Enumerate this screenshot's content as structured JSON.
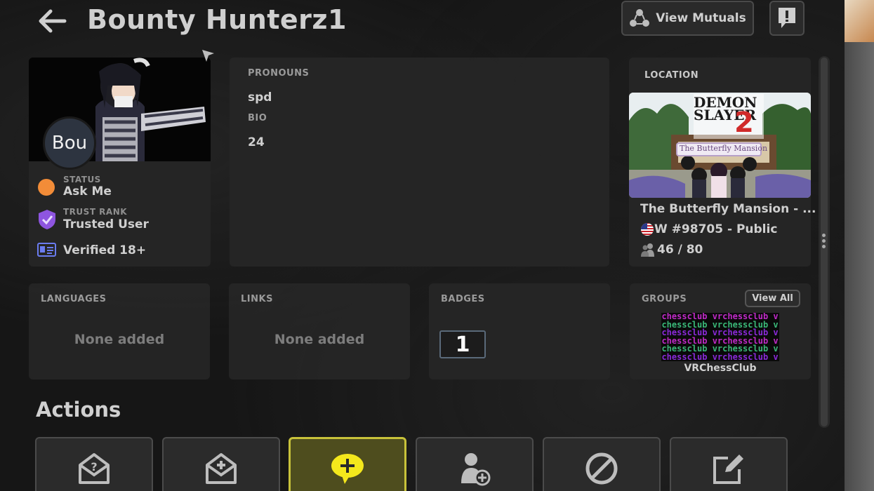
{
  "header": {
    "title": "Bounty Hunterz1",
    "view_mutuals_label": "View Mutuals"
  },
  "profile": {
    "avatar_initials": "Bou",
    "status_label": "STATUS",
    "status_value": "Ask Me",
    "status_color": "#f28c38",
    "trust_rank_label": "TRUST RANK",
    "trust_rank_value": "Trusted User",
    "trust_color": "#8e55e0",
    "verified_label": "Verified 18+",
    "verified_color": "#6a7cf0"
  },
  "about": {
    "pronouns_label": "PRONOUNS",
    "pronouns_value": "spd",
    "bio_label": "BIO",
    "bio_value": "24"
  },
  "location": {
    "label": "LOCATION",
    "world_name": "The Butterfly Mansion - ...",
    "instance": "W #98705 - Public",
    "population": "46 / 80",
    "thumbnail_title_1": "DEMON",
    "thumbnail_title_2": "SLAYER",
    "thumbnail_subtitle": "The Butterfly Mansion"
  },
  "languages": {
    "label": "LANGUAGES",
    "value": "None added"
  },
  "links": {
    "label": "LINKS",
    "value": "None added"
  },
  "badges": {
    "label": "BADGES",
    "count": "1"
  },
  "groups": {
    "label": "GROUPS",
    "view_all_label": "View All",
    "group_name": "VRChessClub",
    "banner_text": "vrchessclub"
  },
  "actions": {
    "title": "Actions",
    "buttons": [
      {
        "icon": "envelope-question-icon"
      },
      {
        "icon": "envelope-plus-icon"
      },
      {
        "icon": "chat-plus-icon"
      },
      {
        "icon": "add-friend-icon"
      },
      {
        "icon": "block-icon"
      },
      {
        "icon": "edit-note-icon"
      }
    ]
  },
  "colors": {
    "accent_yellow": "#f4e81c",
    "card_bg": "#262626",
    "background": "#161616"
  }
}
